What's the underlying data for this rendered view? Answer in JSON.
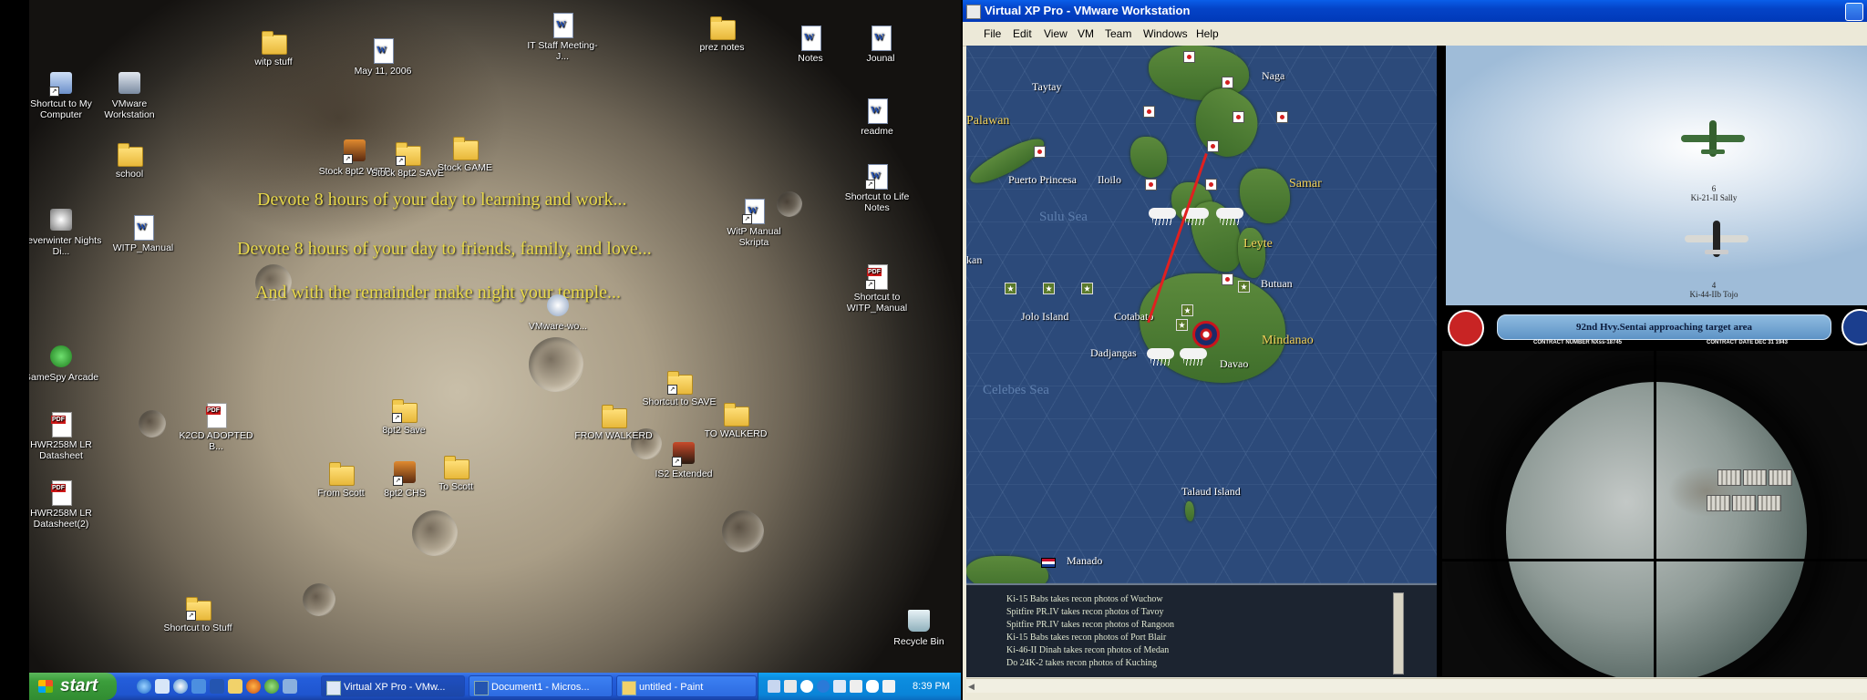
{
  "desktop": {
    "quotes": [
      "Devote 8 hours of your day to learning and work...",
      "Devote 8 hours of your day to friends, family, and love...",
      "And with the remainder make night your temple..."
    ],
    "icons": [
      {
        "label": "Shortcut to My Computer"
      },
      {
        "label": "VMware Workstation"
      },
      {
        "label": "school"
      },
      {
        "label": "Neverwinter Nights Di..."
      },
      {
        "label": "WITP_Manual"
      },
      {
        "label": "GameSpy Arcade"
      },
      {
        "label": "HWR258M LR Datasheet"
      },
      {
        "label": "HWR258M LR Datasheet(2)"
      },
      {
        "label": "Shortcut to Stuff"
      },
      {
        "label": "witp stuff"
      },
      {
        "label": "May 11, 2006"
      },
      {
        "label": "Stock 8pt2 WITP"
      },
      {
        "label": "Stock 8pt2 SAVE"
      },
      {
        "label": "Stock GAME"
      },
      {
        "label": "IT Staff Meeting-J..."
      },
      {
        "label": "prez notes"
      },
      {
        "label": "Notes"
      },
      {
        "label": "Jounal"
      },
      {
        "label": "readme"
      },
      {
        "label": "Shortcut to Life Notes"
      },
      {
        "label": "WitP Manual Skripta"
      },
      {
        "label": "Shortcut to WITP_Manual"
      },
      {
        "label": "VMware-wo..."
      },
      {
        "label": "K2CD ADOPTED B..."
      },
      {
        "label": "8pt2 Save"
      },
      {
        "label": "From Scott"
      },
      {
        "label": "8pt2 CHS"
      },
      {
        "label": "To Scott"
      },
      {
        "label": "FROM WALKERD"
      },
      {
        "label": "Shortcut to SAVE"
      },
      {
        "label": "TO WALKERD"
      },
      {
        "label": "IS2 Extended"
      },
      {
        "label": "Recycle Bin"
      }
    ]
  },
  "taskbar": {
    "start_label": "start",
    "tasks": [
      {
        "label": "Virtual XP Pro - VMw..."
      },
      {
        "label": "Document1 - Micros..."
      },
      {
        "label": "untitled - Paint"
      }
    ],
    "clock": "8:39 PM"
  },
  "vm": {
    "title": "Virtual XP Pro - VMware Workstation",
    "menu": [
      "File",
      "Edit",
      "View",
      "VM",
      "Team",
      "Windows",
      "Help"
    ]
  },
  "game": {
    "map_labels": {
      "taytay": "Taytay",
      "naga": "Naga",
      "palawan": "Palawan",
      "puerto": "Puerto Princesa",
      "iloilo": "Iloilo",
      "samar": "Samar",
      "sulu": "Sulu Sea",
      "leyte": "Leyte",
      "kan": "kan",
      "butuan": "Butuan",
      "jolo": "Jolo Island",
      "cotabato": "Cotabato",
      "mindanao": "Mindanao",
      "dadjangas": "Dadjangas",
      "davao": "Davao",
      "celebes": "Celebes Sea",
      "talaud": "Talaud Island",
      "manado": "Manado"
    },
    "log": [
      "Ki-15 Babs takes recon photos of Wuchow",
      "Spitfire PR.IV takes recon photos of Tavoy",
      "Spitfire PR.IV takes recon photos of Rangoon",
      "Ki-15 Babs takes recon photos of Port Blair",
      "Ki-46-II Dinah takes recon photos of Medan",
      "Do 24K-2 takes recon photos of Kuching"
    ],
    "aircraft": [
      {
        "count": "6",
        "name": "Ki-21-II Sally"
      },
      {
        "count": "4",
        "name": "Ki-44-IIb Tojo"
      }
    ],
    "banner": {
      "text": "92nd Hvy.Sentai approaching target area",
      "contract_number": "CONTRACT NUMBER  NXss-18745",
      "contract_date": "CONTRACT DATE  DEC 31  1943"
    }
  }
}
